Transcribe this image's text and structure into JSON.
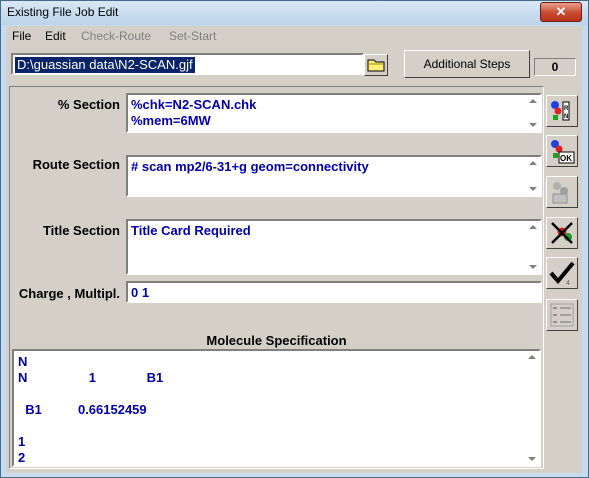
{
  "window": {
    "title": "Existing File Job Edit",
    "close_glyph": "✕"
  },
  "menu": [
    {
      "label": "File",
      "enabled": true
    },
    {
      "label": "Edit",
      "enabled": true
    },
    {
      "label": "Check-Route",
      "enabled": false
    },
    {
      "label": "Set-Start",
      "enabled": false
    }
  ],
  "file": {
    "path": "D:\\guassian data\\N2-SCAN.gjf"
  },
  "toolbar": {
    "additional_steps_label": "Additional Steps",
    "step_count": "0"
  },
  "sections": {
    "percent": {
      "label": "% Section",
      "lines": [
        "%chk=N2-SCAN.chk",
        "%mem=6MW"
      ]
    },
    "route": {
      "label": "Route Section",
      "lines": [
        "# scan mp2/6-31+g geom=connectivity"
      ]
    },
    "title": {
      "label": "Title Section",
      "lines": [
        "Title Card Required"
      ]
    },
    "charge": {
      "label": "Charge , Multipl.",
      "value": "0 1"
    }
  },
  "molecule": {
    "header": "Molecule Specification",
    "text": "N\nN                 1              B1\n\n  B1          0.66152459\n\n1\n2"
  },
  "side_buttons": [
    {
      "name": "run-icon",
      "enabled": true
    },
    {
      "name": "ok-icon",
      "enabled": true
    },
    {
      "name": "molecule-edit-icon",
      "enabled": false
    },
    {
      "name": "cancel-icon",
      "enabled": true
    },
    {
      "name": "check-icon",
      "enabled": true
    },
    {
      "name": "list-icon",
      "enabled": false
    }
  ],
  "colors": {
    "text_blue": "#0000a8",
    "selection": "#0a246a",
    "face": "#d4d0c8"
  }
}
